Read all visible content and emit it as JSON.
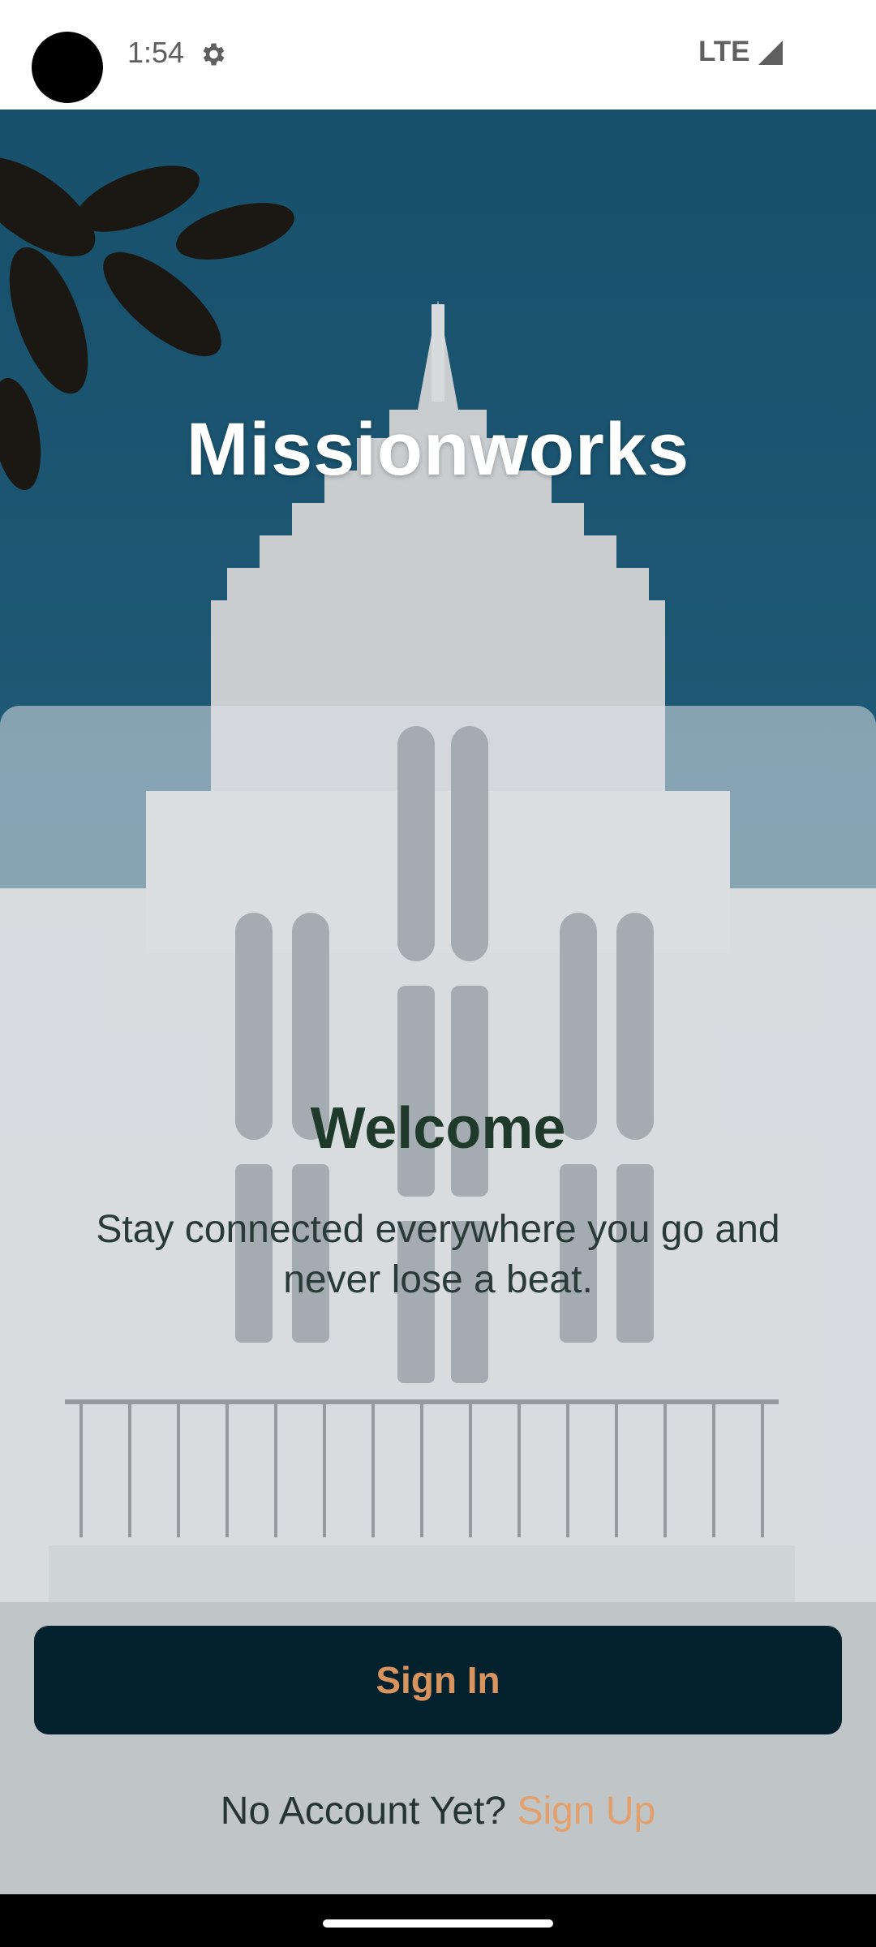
{
  "status_bar": {
    "time": "1:54",
    "network": "LTE",
    "icons": [
      "settings-gear-icon",
      "cell-signal-icon"
    ]
  },
  "app": {
    "title": "Missionworks"
  },
  "welcome": {
    "heading": "Welcome",
    "tagline": "Stay connected everywhere you go and never lose a beat."
  },
  "actions": {
    "sign_in_label": "Sign In",
    "no_account_text": "No Account Yet?",
    "sign_up_label": "Sign Up"
  },
  "colors": {
    "primary_button": "#03222d",
    "accent": "#d9935e",
    "heading": "#1f3a2a",
    "sky": "#1d5570"
  }
}
